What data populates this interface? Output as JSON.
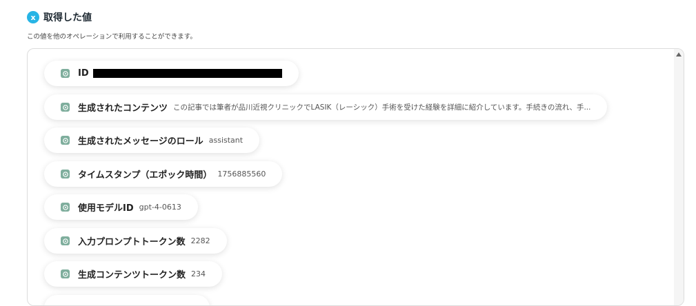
{
  "header": {
    "badge_glyph": "x",
    "title": "取得した値",
    "subtitle": "この値を他のオペレーションで利用することができます。"
  },
  "items": [
    {
      "label": "ID",
      "value": "",
      "redacted": true
    },
    {
      "label": "生成されたコンテンツ",
      "value": "この記事では筆者が品川近視クリニックでLASIK（レーシック）手術を受けた経験を詳細に紹介しています。手続きの流れ、手..."
    },
    {
      "label": "生成されたメッセージのロール",
      "value": "assistant"
    },
    {
      "label": "タイムスタンプ（エポック時間）",
      "value": "1756885560"
    },
    {
      "label": "使用モデルID",
      "value": "gpt-4-0613"
    },
    {
      "label": "入力プロンプトトークン数",
      "value": "2282"
    },
    {
      "label": "生成コンテンツトークン数",
      "value": "234"
    }
  ],
  "colors": {
    "accent": "#27b4e5",
    "item_icon": "#7fae9d"
  },
  "icons": {
    "header": "x-badge-icon",
    "item": "openai-icon",
    "scroll": "scroll-up-arrow-icon"
  }
}
